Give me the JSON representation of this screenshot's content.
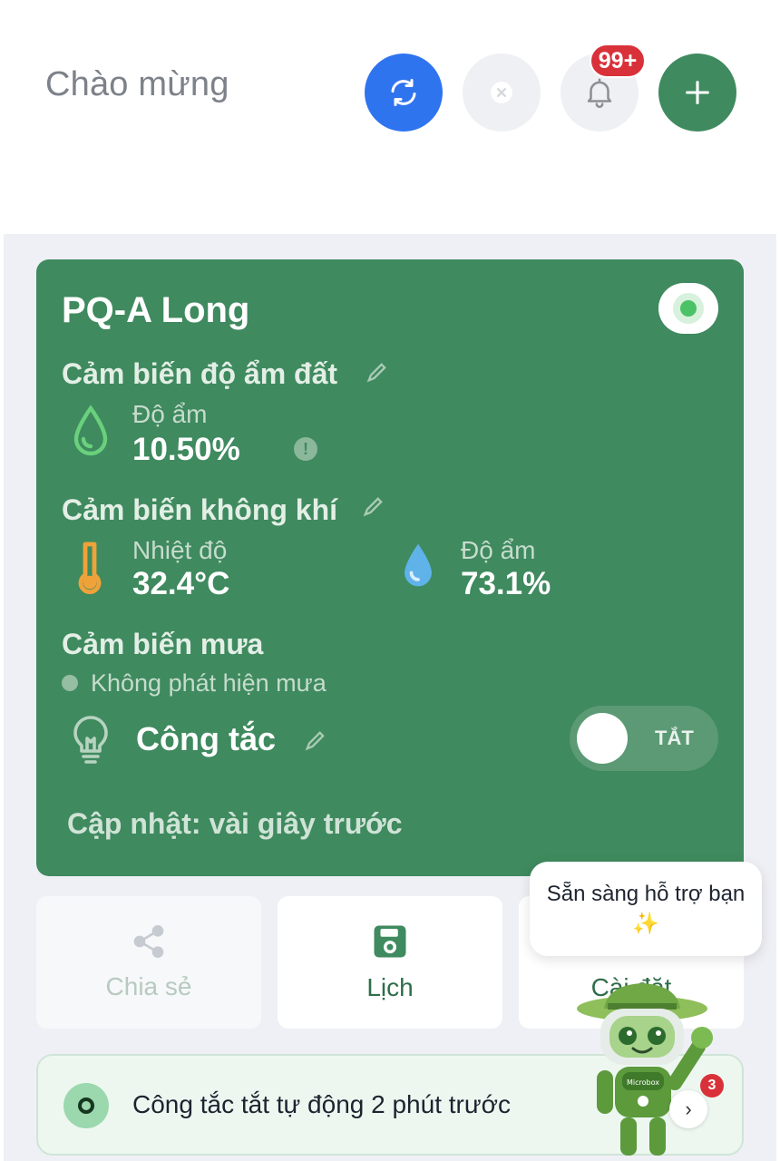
{
  "header": {
    "greeting": "Chào mừng",
    "notification_count": "99+"
  },
  "device": {
    "name": "PQ-A Long",
    "online": true,
    "soil_sensor": {
      "title": "Cảm biến độ ẩm đất",
      "humidity_label": "Độ ẩm",
      "humidity_value": "10.50%"
    },
    "air_sensor": {
      "title": "Cảm biến không khí",
      "temp_label": "Nhiệt độ",
      "temp_value": "32.4°C",
      "humidity_label": "Độ ẩm",
      "humidity_value": "73.1%"
    },
    "rain_sensor": {
      "title": "Cảm biến mưa",
      "status": "Không phát hiện mưa"
    },
    "switch": {
      "label": "Công tắc",
      "state_label": "TẮT",
      "on": false
    },
    "updated": "Cập nhật: vài giây trước"
  },
  "actions": {
    "share": "Chia sẻ",
    "schedule": "Lịch",
    "settings": "Cài đặt"
  },
  "assistant": {
    "bubble": "Sẵn sàng hỗ trợ bạn ✨",
    "badge": "3",
    "robot_text": "Microbox"
  },
  "notice": {
    "text": "Công tắc tắt tự động 2 phút trước"
  },
  "colors": {
    "card": "#3f8a5f",
    "refresh": "#2f74ef",
    "add": "#3f8a5f",
    "badge": "#d9313a"
  }
}
